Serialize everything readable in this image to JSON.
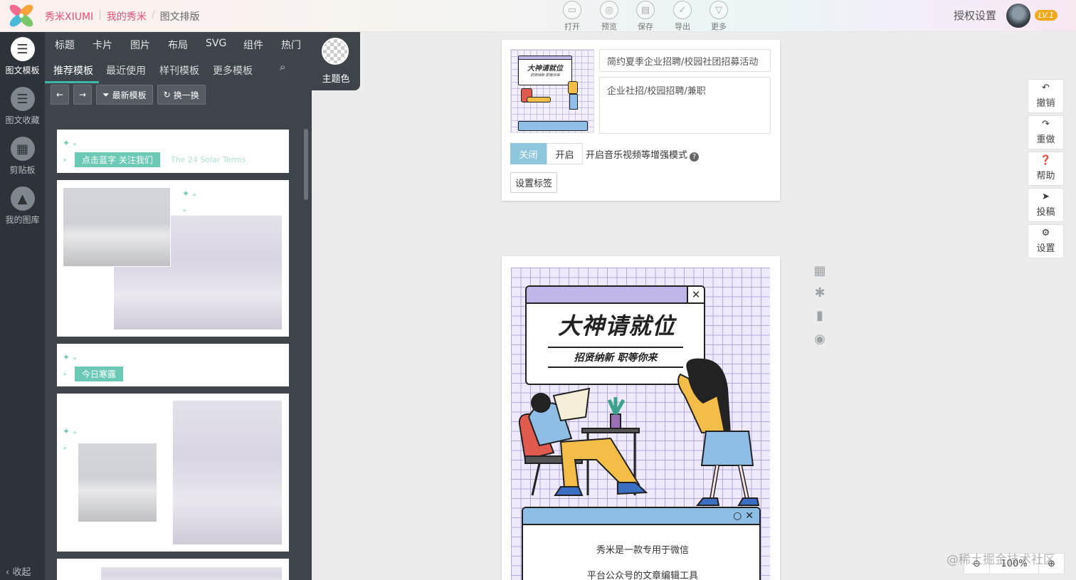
{
  "topbar": {
    "brand": "秀米XIUMI",
    "crumb1": "我的秀米",
    "crumb2": "图文排版",
    "tools": [
      {
        "label": "打开",
        "icon": "folder-icon"
      },
      {
        "label": "预览",
        "icon": "preview-icon"
      },
      {
        "label": "保存",
        "icon": "save-icon"
      },
      {
        "label": "导出",
        "icon": "check-icon"
      },
      {
        "label": "更多",
        "icon": "chevron-down-icon"
      }
    ],
    "auth": "授权设置",
    "level": "LV.1"
  },
  "iconbar": {
    "items": [
      {
        "label": "图文模板",
        "icon": "list-icon"
      },
      {
        "label": "图文收藏",
        "icon": "favorite-icon"
      },
      {
        "label": "剪贴板",
        "icon": "clipboard-icon"
      },
      {
        "label": "我的图库",
        "icon": "gallery-icon"
      }
    ],
    "collapse": "收起"
  },
  "panel": {
    "categories": [
      "标题",
      "卡片",
      "图片",
      "布局",
      "SVG",
      "组件",
      "热门"
    ],
    "subtabs": [
      "推荐模板",
      "最近使用",
      "样刊模板",
      "更多模板"
    ],
    "theme_label": "主题色",
    "btn_latest": "最新模板",
    "btn_shuffle": "换一换",
    "cards": {
      "c1_tag": "点击蓝字 关注我们",
      "c1_sub": "The 24 Solar Terms",
      "c3_tag": "今日寒露"
    }
  },
  "editor": {
    "title_value": "简约夏季企业招聘/校园社团招募活动",
    "desc_value": "企业社招/校园招聘/兼职",
    "toggle_off": "关闭",
    "toggle_on": "开启",
    "mode_text": "开启音乐视频等增强模式",
    "set_tag": "设置标签",
    "thumb_title": "大神请就位",
    "thumb_sub": "招贤纳新 职等你来"
  },
  "poster": {
    "title": "大神请就位",
    "subtitle": "招贤纳新 职等你来",
    "line1": "秀米是一款专用于微信",
    "line2": "平台公众号的文章编辑工具"
  },
  "rightbar": [
    {
      "label": "撤销",
      "icon": "undo-icon"
    },
    {
      "label": "重做",
      "icon": "redo-icon"
    },
    {
      "label": "帮助",
      "icon": "help-icon"
    },
    {
      "label": "投稿",
      "icon": "send-icon"
    },
    {
      "label": "设置",
      "icon": "gear-icon"
    }
  ],
  "zoom": {
    "value": "100%"
  },
  "watermark": "@稀土掘金技术社区",
  "colors": {
    "brand": "#e2517a",
    "mint": "#6cc9b6",
    "panel": "#3e444a",
    "accent": "#3fb8a8"
  }
}
